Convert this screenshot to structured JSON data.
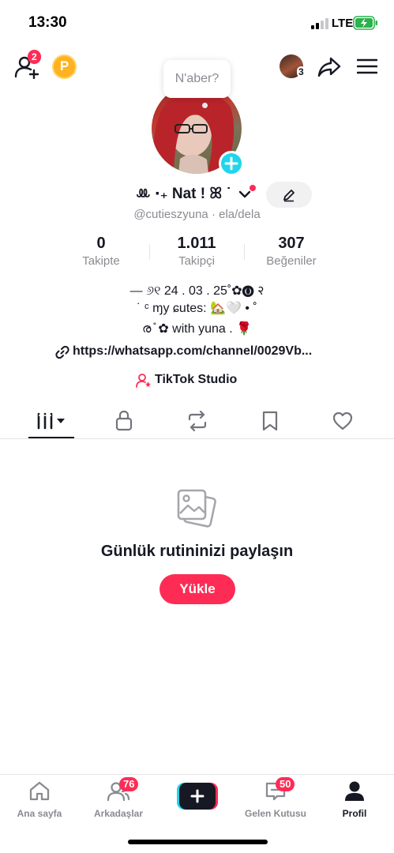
{
  "status_bar": {
    "time": "13:30",
    "network": "LTE"
  },
  "topbar": {
    "friend_requests_count": "2",
    "coin_label": "P",
    "story_count": "3"
  },
  "profile": {
    "bubble_text": "N'aber?",
    "display_name": "ꔛ ‧₊ Nat ! ꕤ ˙",
    "username": "@cutieszyuna",
    "pronouns": " · ela/dela",
    "stats": [
      {
        "value": "0",
        "label": "Takipte"
      },
      {
        "value": "1.011",
        "label": "Takipçi"
      },
      {
        "value": "307",
        "label": "Beğeniler"
      }
    ],
    "bio_lines": [
      "— ୬୧ 24 . 03 . 25˚✿🅞 २",
      "˙ ᶜ ɱy ɕuteѕ: 🏡🤍 • ˚",
      "ര ̊ ✿ with yuna . 🌹"
    ],
    "link": "https://whatsapp.com/channel/0029Vb...",
    "studio": "TikTok Studio"
  },
  "empty_state": {
    "title": "Günlük rutininizi paylaşın",
    "button": "Yükle"
  },
  "bottom_nav": {
    "items": [
      {
        "label": "Ana sayfa"
      },
      {
        "label": "Arkadaşlar",
        "badge": "76"
      },
      {
        "label": ""
      },
      {
        "label": "Gelen Kutusu",
        "badge": "50"
      },
      {
        "label": "Profil"
      }
    ]
  },
  "colors": {
    "accent": "#fe2c55",
    "cyan": "#20d5ec",
    "muted": "#8a8b91",
    "text": "#161823"
  }
}
